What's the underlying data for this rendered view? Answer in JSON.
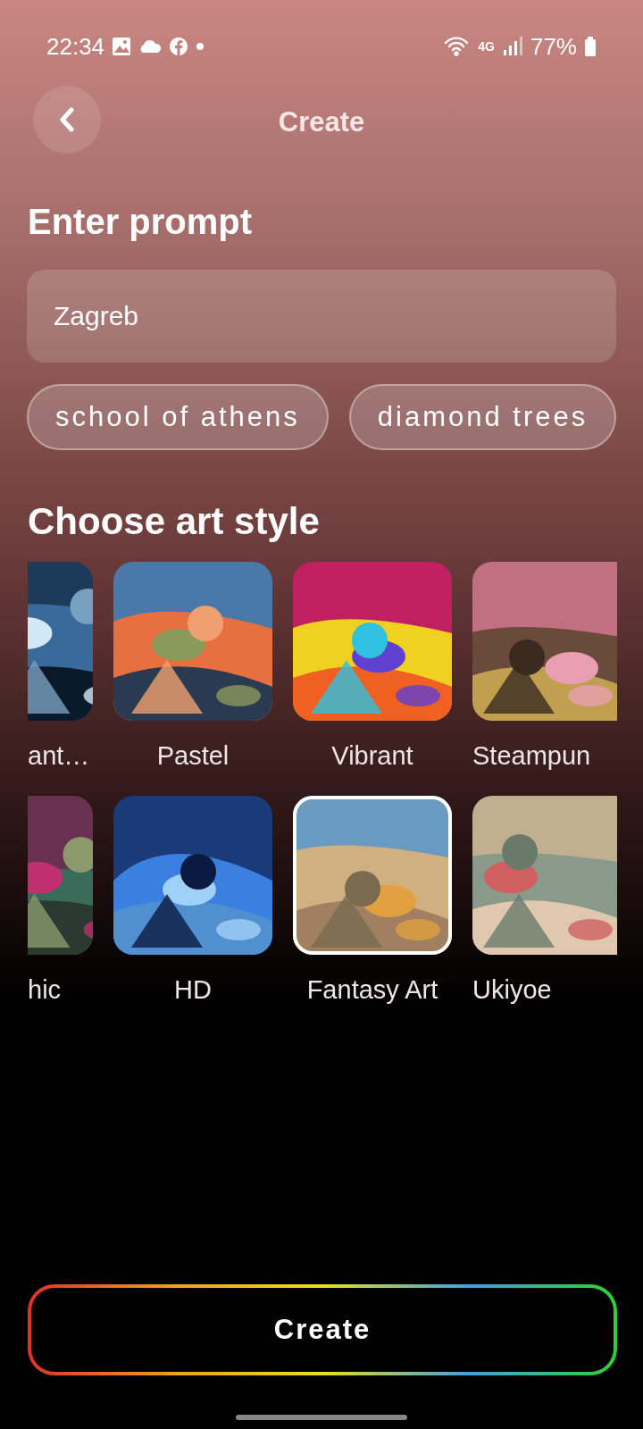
{
  "status_bar": {
    "time": "22:34",
    "network_type": "4G",
    "battery": "77%"
  },
  "header": {
    "title": "Create"
  },
  "prompt": {
    "heading": "Enter prompt",
    "value": "Zagreb"
  },
  "suggestions": [
    "school of athens",
    "diamond trees"
  ],
  "styles_heading": "Choose art style",
  "styles": [
    {
      "label": "ant…",
      "selected": false
    },
    {
      "label": "Pastel",
      "selected": false
    },
    {
      "label": "Vibrant",
      "selected": false
    },
    {
      "label": "Steampun",
      "selected": false
    },
    {
      "label": "hic",
      "selected": false
    },
    {
      "label": "HD",
      "selected": false
    },
    {
      "label": "Fantasy Art",
      "selected": true
    },
    {
      "label": "Ukiyoe",
      "selected": false
    }
  ],
  "create_button": "Create"
}
